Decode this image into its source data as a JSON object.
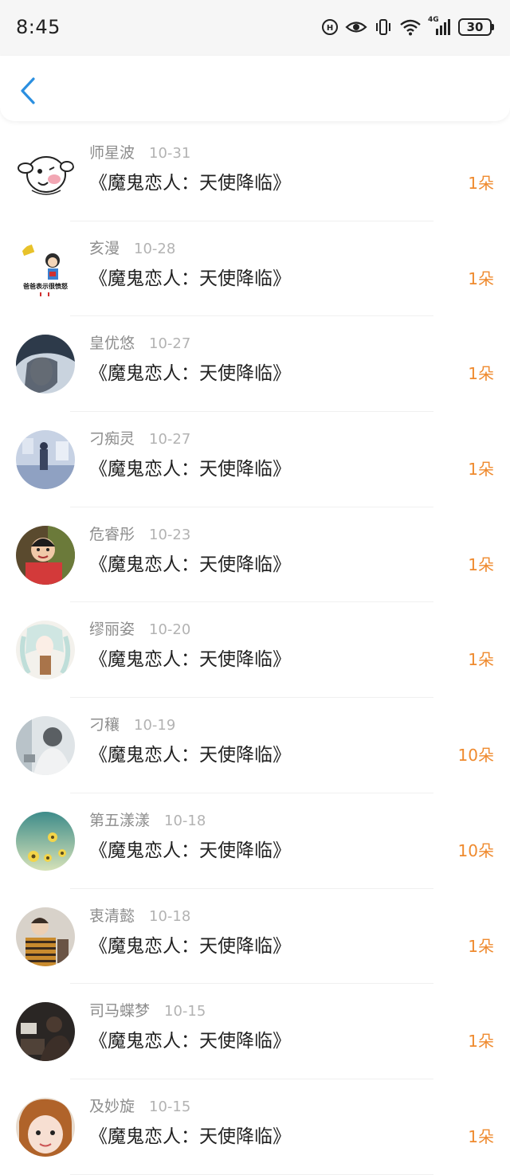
{
  "status_bar": {
    "time": "8:45",
    "network_label": "4G",
    "battery": "30",
    "icons": [
      "hd-icon",
      "eye-icon",
      "vibrate-icon",
      "wifi-icon",
      "signal-icon",
      "battery-icon"
    ]
  },
  "nav": {
    "back_icon": "chevron-left-icon",
    "accent": "#2b8fe0"
  },
  "colors": {
    "count": "#ef8a2e",
    "name": "#8d8d8d",
    "date": "#b3b3b3"
  },
  "gifts": [
    {
      "name": "师星波",
      "date": "10-31",
      "title": "《魔鬼恋人：天使降临》",
      "count": "1朵",
      "avatar": "cartoon-face"
    },
    {
      "name": "亥漫",
      "date": "10-28",
      "title": "《魔鬼恋人：天使降临》",
      "count": "1朵",
      "avatar": "cartoon-meme",
      "avatar_text": "爸爸表示很愤怒"
    },
    {
      "name": "皇优悠",
      "date": "10-27",
      "title": "《魔鬼恋人：天使降临》",
      "count": "1朵",
      "avatar": "dark-portrait"
    },
    {
      "name": "刁痴灵",
      "date": "10-27",
      "title": "《魔鬼恋人：天使降临》",
      "count": "1朵",
      "avatar": "blue-scene"
    },
    {
      "name": "危睿彤",
      "date": "10-23",
      "title": "《魔鬼恋人：天使降临》",
      "count": "1朵",
      "avatar": "child-photo"
    },
    {
      "name": "缪丽姿",
      "date": "10-20",
      "title": "《魔鬼恋人：天使降临》",
      "count": "1朵",
      "avatar": "anime-girl"
    },
    {
      "name": "刁穰",
      "date": "10-19",
      "title": "《魔鬼恋人：天使降临》",
      "count": "10朵",
      "avatar": "grey-portrait"
    },
    {
      "name": "第五漾漾",
      "date": "10-18",
      "title": "《魔鬼恋人：天使降临》",
      "count": "10朵",
      "avatar": "flowers-sky"
    },
    {
      "name": "衷清懿",
      "date": "10-18",
      "title": "《魔鬼恋人：天使降临》",
      "count": "1朵",
      "avatar": "striped-shirt"
    },
    {
      "name": "司马蝶梦",
      "date": "10-15",
      "title": "《魔鬼恋人：天使降临》",
      "count": "1朵",
      "avatar": "dark-room"
    },
    {
      "name": "及妙旋",
      "date": "10-15",
      "title": "《魔鬼恋人：天使降临》",
      "count": "1朵",
      "avatar": "girl-face"
    }
  ]
}
